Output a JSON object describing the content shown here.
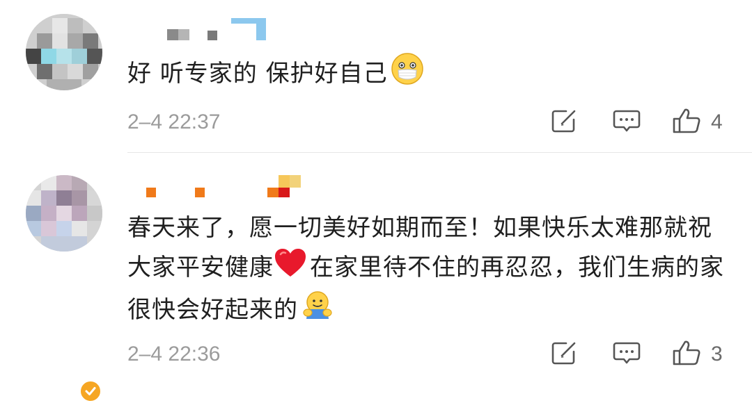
{
  "comments": [
    {
      "text": "好 听专家的 保护好自己",
      "emoji_icon": "mask-face-emoji",
      "timestamp": "2–4 22:37",
      "like_count": "4",
      "verified": false
    },
    {
      "text_part1": "春天来了，愿一切美好如期而至！如果快乐太难那就祝大家平安健康",
      "text_part2": "在家里待不住的再忍忍，我们生病的家很快会好起来的",
      "emoji_icon_1": "red-heart-emoji",
      "emoji_icon_2": "hugging-face-emoji",
      "timestamp": "2–4 22:36",
      "like_count": "3",
      "verified": true
    }
  ],
  "icons": {
    "repost": "share-edit-icon",
    "reply": "comment-bubble-icon",
    "like": "thumbs-up-icon",
    "verified": "verified-check-icon"
  },
  "colors": {
    "timestamp": "#9b9b9b",
    "verified": "#f6a623",
    "heart": "#e8192c"
  }
}
